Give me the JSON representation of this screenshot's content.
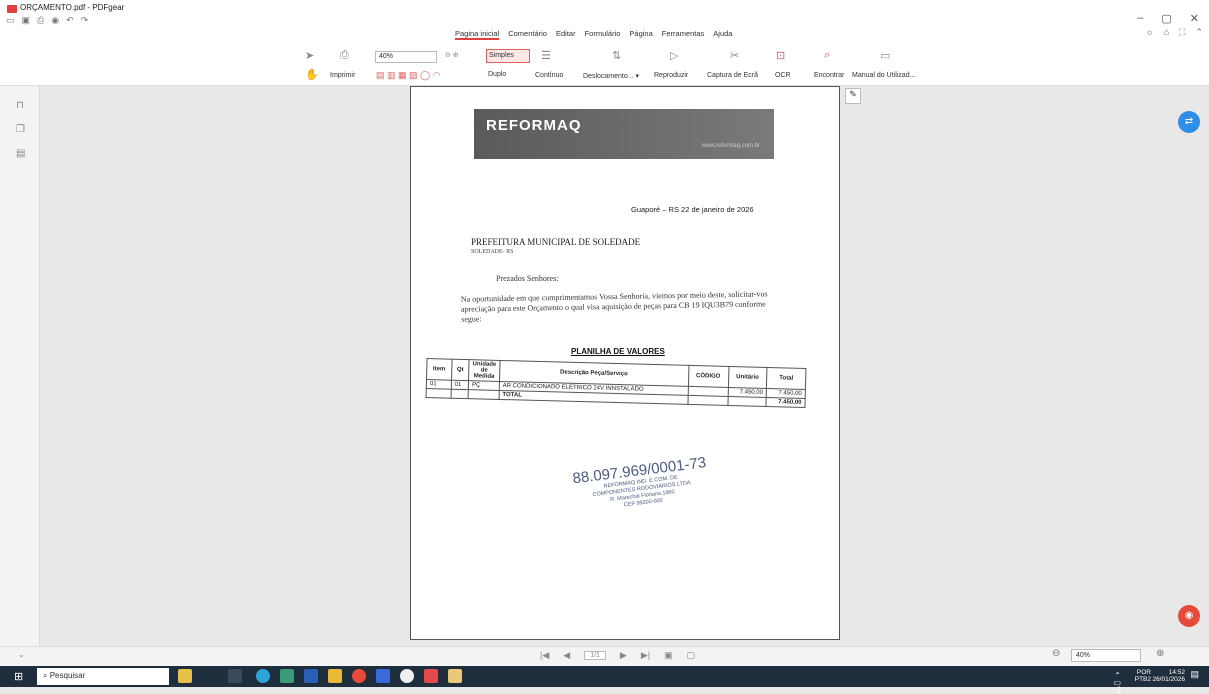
{
  "window": {
    "title": "ORÇAMENTO.pdf - PDFgear"
  },
  "menu": [
    "Pagina inicial",
    "Comentário",
    "Editar",
    "Formulário",
    "Página",
    "Ferramentas",
    "Ajuda"
  ],
  "ribbon": {
    "imprimir": "Imprimir",
    "zoom": "40%",
    "simples": "Simples",
    "duplo": "Duplo",
    "continuo": "Contínuo",
    "deslocamento": "Deslocamento... ▾",
    "reproduzir": "Reproduzir",
    "captura": "Captura de Ecrã",
    "ocr": "OCR",
    "encontrar": "Encontrar",
    "manual": "Manual do Utilizad..."
  },
  "doc": {
    "logo": "REFORMAQ",
    "url": "www.reformaq.com.br",
    "date": "Guaporé – RS 22 de janeiro de 2026",
    "recipient": "PREFEITURA MUNICIPAL DE SOLEDADE",
    "recipient2": "SOLEDADE- RS",
    "greeting": "Prezados Senhores:",
    "paragraph": "Na oportunidade em que cumprimentamos Vossa Senhoria, viemos por meio deste, solicitar-vos apreciação para este Orçamento o qual visa aquisição de peças para CB 19 IQU3B79 conforme segue:",
    "table_title": "PLANILHA DE VALORES",
    "headers": [
      "Item",
      "Qt",
      "Unidade de Medida",
      "Descrição Peça/Serviço",
      "CÓDIGO",
      "Unitário",
      "Total"
    ],
    "row": [
      "01",
      "01",
      "PÇ",
      "AR CONDICIONADO ELETRICO 24V INNSTALADO",
      "",
      "7.450,00",
      "7.450,00"
    ],
    "total_label": "TOTAL",
    "total_value": "7.450,00",
    "stamp": {
      "cnpj": "88.097.969/0001-73",
      "l1": "REFORMAQ IND. E COM. DE",
      "l2": "COMPONENTES RODOVIÁRIOS LTDA",
      "l3": "R. Marechal Floriano,1960",
      "l4": "CEP 99200-000"
    }
  },
  "status": {
    "page": "1/1",
    "zoom": "40%"
  },
  "taskbar": {
    "search": "Pesquisar",
    "lang1": "POR",
    "lang2": "PTB2",
    "time": "14:52",
    "date": "26/01/2026"
  }
}
